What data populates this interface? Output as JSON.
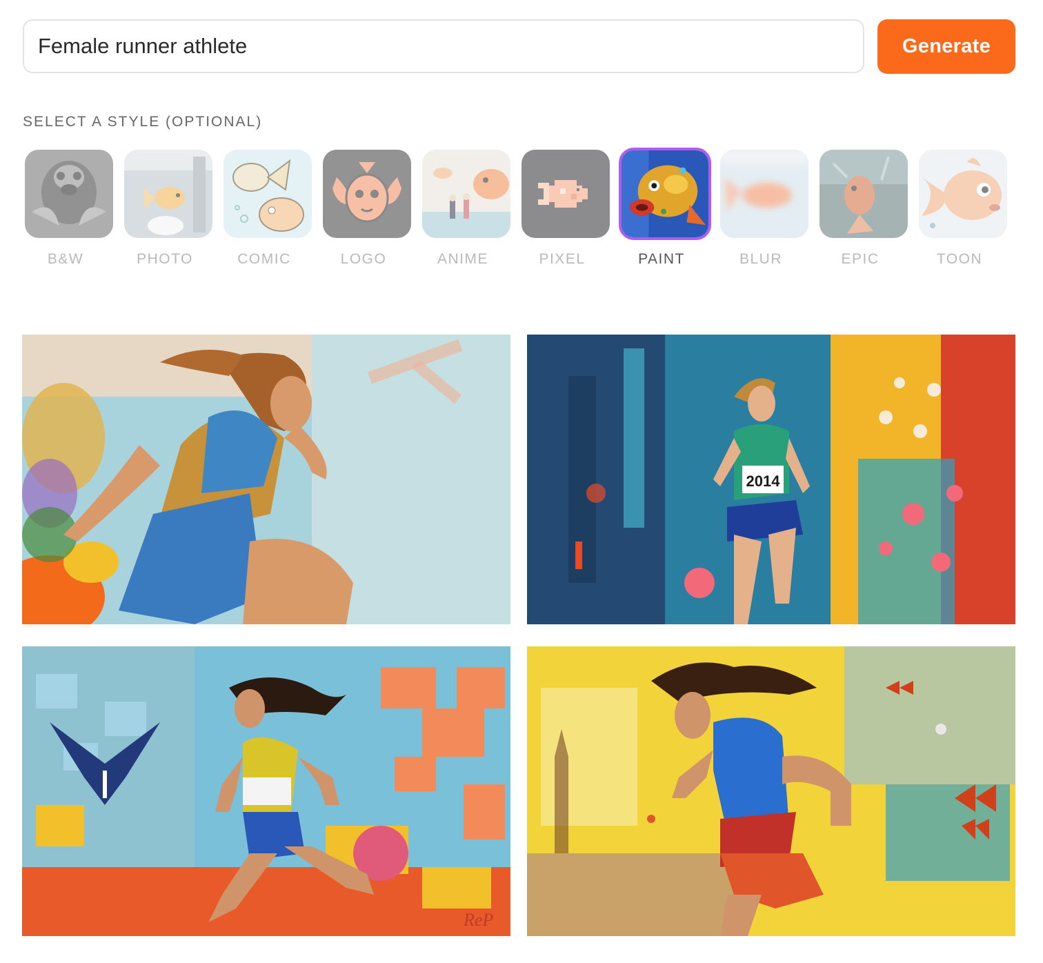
{
  "prompt": {
    "value": "Female runner athlete",
    "generate_label": "Generate"
  },
  "styles": {
    "heading": "SELECT A STYLE (OPTIONAL)",
    "selected": "PAINT",
    "items": [
      {
        "label": "B&W"
      },
      {
        "label": "PHOTO"
      },
      {
        "label": "COMIC"
      },
      {
        "label": "LOGO"
      },
      {
        "label": "ANIME"
      },
      {
        "label": "PIXEL"
      },
      {
        "label": "PAINT"
      },
      {
        "label": "BLUR"
      },
      {
        "label": "EPIC"
      },
      {
        "label": "TOON"
      }
    ]
  },
  "results": {
    "images": [
      {
        "description": "painted female runner, blue tank top, light blue background"
      },
      {
        "description": "painted female runner, race bib, teal background with flowers",
        "bib_text": "2014"
      },
      {
        "description": "painted female runner with puzzle-piece background and bird"
      },
      {
        "description": "painted female runner, blue top, yellow splash background with butterflies"
      }
    ]
  },
  "colors": {
    "accent": "#fb6a1a",
    "selected_border": "#b05cf0"
  }
}
